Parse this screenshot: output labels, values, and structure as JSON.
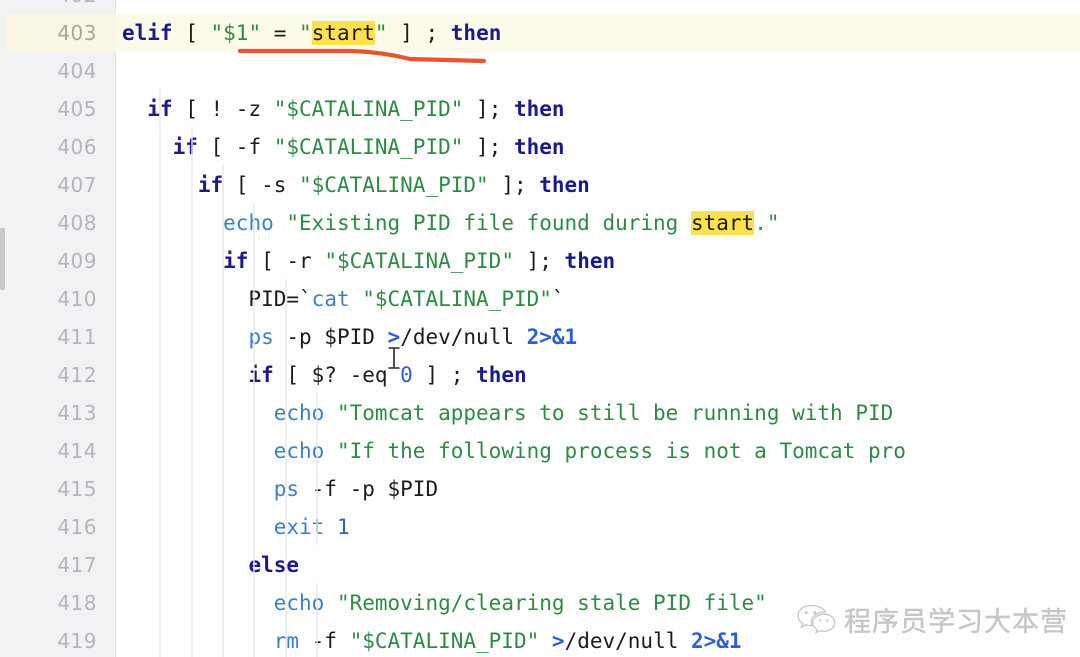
{
  "editor": {
    "app_kind": "code-editor",
    "language": "shell",
    "active_line": 403,
    "first_partial_line": 402,
    "colors": {
      "background": "#ffffff",
      "gutter": "#f1f2f4",
      "active_line": "#fcfae8",
      "keyword": "#1a1a8c",
      "command": "#3b82c4",
      "string": "#2e8b45",
      "number": "#2b5fd9",
      "search_highlight": "#ffe14d",
      "annotation": "#e8552d",
      "line_number": "#b3b6ba",
      "indent_guide": "#e6e7ea"
    },
    "search_term": "start"
  },
  "lines": [
    {
      "number": "403",
      "active": true,
      "indent": 0,
      "tokens": [
        {
          "text": "elif",
          "cls": "t-kw"
        },
        {
          "text": " [ ",
          "cls": "t-pln"
        },
        {
          "text": "\"$1\"",
          "cls": "t-str"
        },
        {
          "text": " = ",
          "cls": "t-pln"
        },
        {
          "text": "\"",
          "cls": "t-str"
        },
        {
          "text": "start",
          "cls": "t-str hl"
        },
        {
          "text": "\"",
          "cls": "t-str"
        },
        {
          "text": " ] ; ",
          "cls": "t-pln"
        },
        {
          "text": "then",
          "cls": "t-kw"
        }
      ]
    },
    {
      "number": "404",
      "active": false,
      "indent": 0,
      "tokens": []
    },
    {
      "number": "405",
      "active": false,
      "indent": 1,
      "tokens": [
        {
          "text": "  ",
          "cls": "t-pln"
        },
        {
          "text": "if",
          "cls": "t-kw"
        },
        {
          "text": " [ ! -z ",
          "cls": "t-pln"
        },
        {
          "text": "\"$CATALINA_PID\"",
          "cls": "t-str"
        },
        {
          "text": " ]; ",
          "cls": "t-pln"
        },
        {
          "text": "then",
          "cls": "t-kw"
        }
      ]
    },
    {
      "number": "406",
      "active": false,
      "indent": 2,
      "tokens": [
        {
          "text": "    ",
          "cls": "t-pln"
        },
        {
          "text": "if",
          "cls": "t-kw"
        },
        {
          "text": " [ -f ",
          "cls": "t-pln"
        },
        {
          "text": "\"$CATALINA_PID\"",
          "cls": "t-str"
        },
        {
          "text": " ]; ",
          "cls": "t-pln"
        },
        {
          "text": "then",
          "cls": "t-kw"
        }
      ]
    },
    {
      "number": "407",
      "active": false,
      "indent": 3,
      "tokens": [
        {
          "text": "      ",
          "cls": "t-pln"
        },
        {
          "text": "if",
          "cls": "t-kw"
        },
        {
          "text": " [ -s ",
          "cls": "t-pln"
        },
        {
          "text": "\"$CATALINA_PID\"",
          "cls": "t-str"
        },
        {
          "text": " ]; ",
          "cls": "t-pln"
        },
        {
          "text": "then",
          "cls": "t-kw"
        }
      ]
    },
    {
      "number": "408",
      "active": false,
      "indent": 4,
      "tokens": [
        {
          "text": "        ",
          "cls": "t-pln"
        },
        {
          "text": "echo",
          "cls": "t-cmd"
        },
        {
          "text": " ",
          "cls": "t-pln"
        },
        {
          "text": "\"Existing PID file found during ",
          "cls": "t-str"
        },
        {
          "text": "start",
          "cls": "t-str hl"
        },
        {
          "text": ".\"",
          "cls": "t-str"
        }
      ]
    },
    {
      "number": "409",
      "active": false,
      "indent": 4,
      "tokens": [
        {
          "text": "        ",
          "cls": "t-pln"
        },
        {
          "text": "if",
          "cls": "t-kw"
        },
        {
          "text": " [ -r ",
          "cls": "t-pln"
        },
        {
          "text": "\"$CATALINA_PID\"",
          "cls": "t-str"
        },
        {
          "text": " ]; ",
          "cls": "t-pln"
        },
        {
          "text": "then",
          "cls": "t-kw"
        }
      ]
    },
    {
      "number": "410",
      "active": false,
      "indent": 5,
      "tokens": [
        {
          "text": "          PID=",
          "cls": "t-pln"
        },
        {
          "text": "`",
          "cls": "t-pln"
        },
        {
          "text": "cat",
          "cls": "t-cmd"
        },
        {
          "text": " ",
          "cls": "t-pln"
        },
        {
          "text": "\"$CATALINA_PID\"",
          "cls": "t-str"
        },
        {
          "text": "`",
          "cls": "t-pln"
        }
      ]
    },
    {
      "number": "411",
      "active": false,
      "indent": 5,
      "tokens": [
        {
          "text": "          ",
          "cls": "t-pln"
        },
        {
          "text": "ps",
          "cls": "t-cmd"
        },
        {
          "text": " -p $PID ",
          "cls": "t-pln"
        },
        {
          "text": ">",
          "cls": "t-op"
        },
        {
          "text": "/dev/null ",
          "cls": "t-pln"
        },
        {
          "text": "2>&1",
          "cls": "t-op"
        }
      ]
    },
    {
      "number": "412",
      "active": false,
      "indent": 5,
      "tokens": [
        {
          "text": "          ",
          "cls": "t-pln"
        },
        {
          "text": "if",
          "cls": "t-kw"
        },
        {
          "text": " [ $? -eq ",
          "cls": "t-pln"
        },
        {
          "text": "0",
          "cls": "t-num"
        },
        {
          "text": " ] ; ",
          "cls": "t-pln"
        },
        {
          "text": "then",
          "cls": "t-kw"
        }
      ]
    },
    {
      "number": "413",
      "active": false,
      "indent": 6,
      "tokens": [
        {
          "text": "            ",
          "cls": "t-pln"
        },
        {
          "text": "echo",
          "cls": "t-cmd"
        },
        {
          "text": " ",
          "cls": "t-pln"
        },
        {
          "text": "\"Tomcat appears to still be running with PID",
          "cls": "t-str"
        }
      ]
    },
    {
      "number": "414",
      "active": false,
      "indent": 6,
      "tokens": [
        {
          "text": "            ",
          "cls": "t-pln"
        },
        {
          "text": "echo",
          "cls": "t-cmd"
        },
        {
          "text": " ",
          "cls": "t-pln"
        },
        {
          "text": "\"If the following process is not a Tomcat pro",
          "cls": "t-str"
        }
      ]
    },
    {
      "number": "415",
      "active": false,
      "indent": 6,
      "tokens": [
        {
          "text": "            ",
          "cls": "t-pln"
        },
        {
          "text": "ps",
          "cls": "t-cmd"
        },
        {
          "text": " -f -p $PID",
          "cls": "t-pln"
        }
      ]
    },
    {
      "number": "416",
      "active": false,
      "indent": 6,
      "tokens": [
        {
          "text": "            ",
          "cls": "t-pln"
        },
        {
          "text": "exit",
          "cls": "t-cmd"
        },
        {
          "text": " ",
          "cls": "t-pln"
        },
        {
          "text": "1",
          "cls": "t-num"
        }
      ]
    },
    {
      "number": "417",
      "active": false,
      "indent": 5,
      "tokens": [
        {
          "text": "          ",
          "cls": "t-pln"
        },
        {
          "text": "else",
          "cls": "t-kw"
        }
      ]
    },
    {
      "number": "418",
      "active": false,
      "indent": 6,
      "tokens": [
        {
          "text": "            ",
          "cls": "t-pln"
        },
        {
          "text": "echo",
          "cls": "t-cmd"
        },
        {
          "text": " ",
          "cls": "t-pln"
        },
        {
          "text": "\"Removing/clearing stale PID file\"",
          "cls": "t-str"
        }
      ]
    },
    {
      "number": "419",
      "active": false,
      "indent": 6,
      "tokens": [
        {
          "text": "            ",
          "cls": "t-pln"
        },
        {
          "text": "rm",
          "cls": "t-cmd"
        },
        {
          "text": " -f ",
          "cls": "t-pln"
        },
        {
          "text": "\"$CATALINA_PID\"",
          "cls": "t-str"
        },
        {
          "text": " ",
          "cls": "t-pln"
        },
        {
          "text": ">",
          "cls": "t-op"
        },
        {
          "text": "/dev/null ",
          "cls": "t-pln"
        },
        {
          "text": "2>&1",
          "cls": "t-op"
        }
      ]
    }
  ],
  "annotation": {
    "kind": "hand-drawn-underline",
    "color": "#e8552d",
    "targets_line": "403",
    "underlines_text": "\"$1\" = \"start\""
  },
  "watermark": {
    "text": "程序员学习大本营",
    "icon": "wechat-icon"
  }
}
